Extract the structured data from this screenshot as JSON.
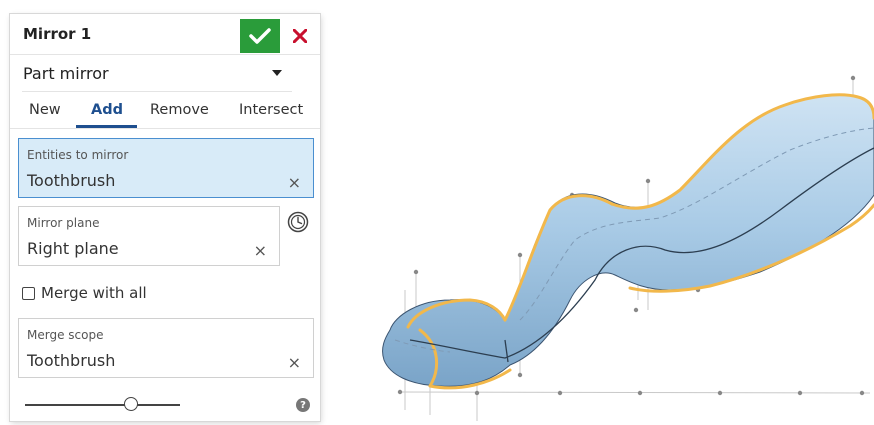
{
  "dialog": {
    "title": "Mirror 1",
    "accept_icon": "checkmark-icon",
    "cancel_icon": "close-icon",
    "mirror_type": {
      "value": "Part mirror"
    },
    "tabs": [
      {
        "label": "New",
        "active": false
      },
      {
        "label": "Add",
        "active": true
      },
      {
        "label": "Remove",
        "active": false
      },
      {
        "label": "Intersect",
        "active": false
      }
    ],
    "entities_to_mirror": {
      "label": "Entities to mirror",
      "value": "Toothbrush",
      "clear": "×",
      "active": true
    },
    "mirror_plane": {
      "label": "Mirror plane",
      "value": "Right plane",
      "clear": "×",
      "history_icon": "clock-icon"
    },
    "merge_with_all": {
      "label": "Merge with all",
      "checked": false
    },
    "merge_scope": {
      "label": "Merge scope",
      "value": "Toothbrush",
      "clear": "×"
    },
    "slider": {
      "icon": "slider-icon"
    },
    "help": {
      "glyph": "?",
      "icon": "help-icon"
    }
  },
  "colors": {
    "accept": "#2a9c3a",
    "cancel": "#c8102e",
    "active_tab": "#1e4f8f",
    "active_field_bg": "#d8ebf8",
    "model_body": "#a9cbe6",
    "model_edge_highlight": "#f2b84b"
  }
}
